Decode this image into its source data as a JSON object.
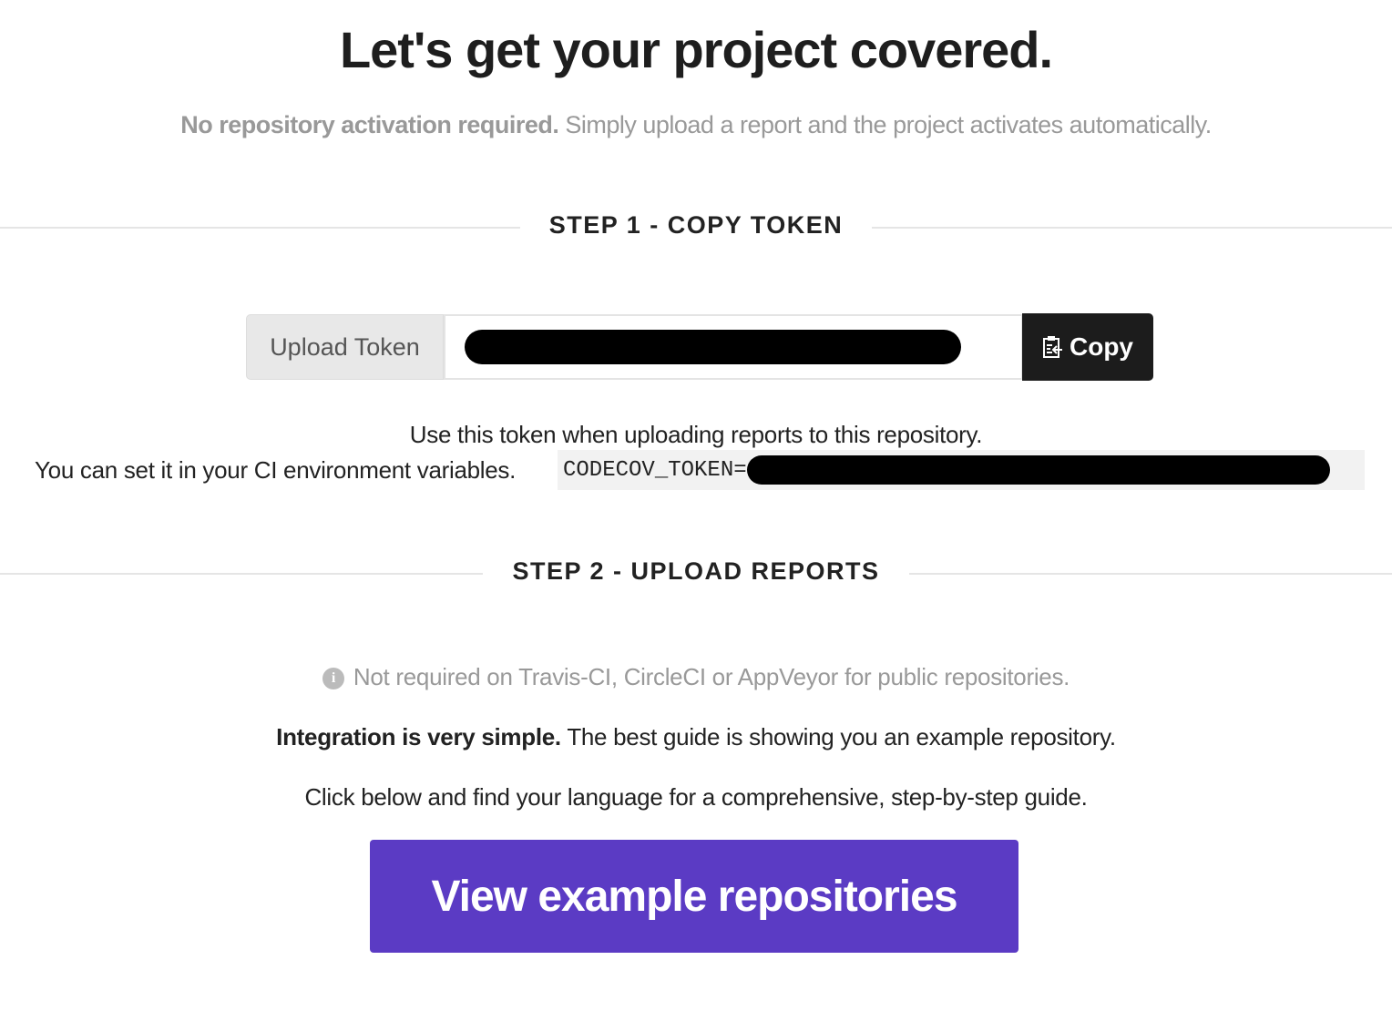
{
  "header": {
    "title": "Let's get your project covered.",
    "subtitle_bold": "No repository activation required.",
    "subtitle_rest": " Simply upload a report and the project activates automatically."
  },
  "step1": {
    "heading": "STEP 1 - COPY TOKEN",
    "token_label": "Upload Token",
    "copy_label": "Copy",
    "line1": "Use this token when uploading reports to this repository.",
    "line2": "You can set it in your CI environment variables.",
    "env_var": "CODECOV_TOKEN="
  },
  "step2": {
    "heading": "STEP 2 - UPLOAD REPORTS",
    "info_glyph": "i",
    "note": "Not required on Travis-CI, CircleCI or AppVeyor for public repositories.",
    "integration_bold": "Integration is very simple.",
    "integration_rest": " The best guide is showing you an example repository.",
    "guide": "Click below and find your language for a comprehensive, step-by-step guide.",
    "button": "View example repositories"
  },
  "colors": {
    "accent": "#5b3bc4",
    "copy_bg": "#1c1c1c"
  }
}
